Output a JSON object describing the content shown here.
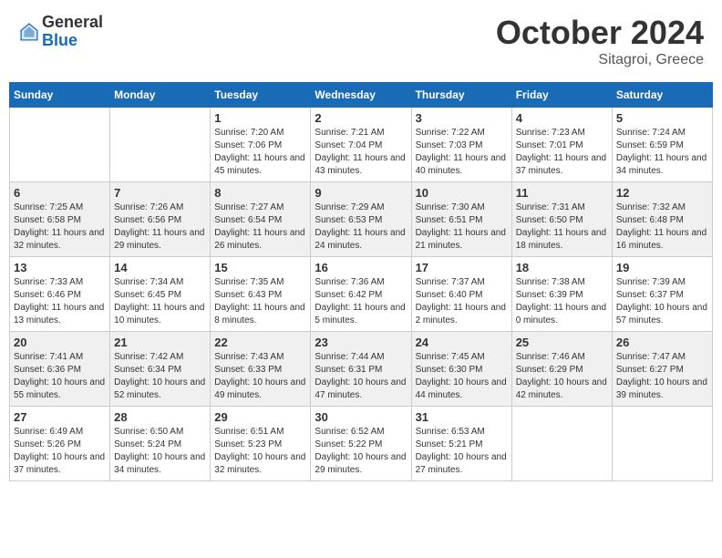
{
  "header": {
    "logo_general": "General",
    "logo_blue": "Blue",
    "month_title": "October 2024",
    "location": "Sitagroi, Greece"
  },
  "days_of_week": [
    "Sunday",
    "Monday",
    "Tuesday",
    "Wednesday",
    "Thursday",
    "Friday",
    "Saturday"
  ],
  "weeks": [
    [
      {
        "day": "",
        "info": ""
      },
      {
        "day": "",
        "info": ""
      },
      {
        "day": "1",
        "info": "Sunrise: 7:20 AM\nSunset: 7:06 PM\nDaylight: 11 hours and 45 minutes."
      },
      {
        "day": "2",
        "info": "Sunrise: 7:21 AM\nSunset: 7:04 PM\nDaylight: 11 hours and 43 minutes."
      },
      {
        "day": "3",
        "info": "Sunrise: 7:22 AM\nSunset: 7:03 PM\nDaylight: 11 hours and 40 minutes."
      },
      {
        "day": "4",
        "info": "Sunrise: 7:23 AM\nSunset: 7:01 PM\nDaylight: 11 hours and 37 minutes."
      },
      {
        "day": "5",
        "info": "Sunrise: 7:24 AM\nSunset: 6:59 PM\nDaylight: 11 hours and 34 minutes."
      }
    ],
    [
      {
        "day": "6",
        "info": "Sunrise: 7:25 AM\nSunset: 6:58 PM\nDaylight: 11 hours and 32 minutes."
      },
      {
        "day": "7",
        "info": "Sunrise: 7:26 AM\nSunset: 6:56 PM\nDaylight: 11 hours and 29 minutes."
      },
      {
        "day": "8",
        "info": "Sunrise: 7:27 AM\nSunset: 6:54 PM\nDaylight: 11 hours and 26 minutes."
      },
      {
        "day": "9",
        "info": "Sunrise: 7:29 AM\nSunset: 6:53 PM\nDaylight: 11 hours and 24 minutes."
      },
      {
        "day": "10",
        "info": "Sunrise: 7:30 AM\nSunset: 6:51 PM\nDaylight: 11 hours and 21 minutes."
      },
      {
        "day": "11",
        "info": "Sunrise: 7:31 AM\nSunset: 6:50 PM\nDaylight: 11 hours and 18 minutes."
      },
      {
        "day": "12",
        "info": "Sunrise: 7:32 AM\nSunset: 6:48 PM\nDaylight: 11 hours and 16 minutes."
      }
    ],
    [
      {
        "day": "13",
        "info": "Sunrise: 7:33 AM\nSunset: 6:46 PM\nDaylight: 11 hours and 13 minutes."
      },
      {
        "day": "14",
        "info": "Sunrise: 7:34 AM\nSunset: 6:45 PM\nDaylight: 11 hours and 10 minutes."
      },
      {
        "day": "15",
        "info": "Sunrise: 7:35 AM\nSunset: 6:43 PM\nDaylight: 11 hours and 8 minutes."
      },
      {
        "day": "16",
        "info": "Sunrise: 7:36 AM\nSunset: 6:42 PM\nDaylight: 11 hours and 5 minutes."
      },
      {
        "day": "17",
        "info": "Sunrise: 7:37 AM\nSunset: 6:40 PM\nDaylight: 11 hours and 2 minutes."
      },
      {
        "day": "18",
        "info": "Sunrise: 7:38 AM\nSunset: 6:39 PM\nDaylight: 11 hours and 0 minutes."
      },
      {
        "day": "19",
        "info": "Sunrise: 7:39 AM\nSunset: 6:37 PM\nDaylight: 10 hours and 57 minutes."
      }
    ],
    [
      {
        "day": "20",
        "info": "Sunrise: 7:41 AM\nSunset: 6:36 PM\nDaylight: 10 hours and 55 minutes."
      },
      {
        "day": "21",
        "info": "Sunrise: 7:42 AM\nSunset: 6:34 PM\nDaylight: 10 hours and 52 minutes."
      },
      {
        "day": "22",
        "info": "Sunrise: 7:43 AM\nSunset: 6:33 PM\nDaylight: 10 hours and 49 minutes."
      },
      {
        "day": "23",
        "info": "Sunrise: 7:44 AM\nSunset: 6:31 PM\nDaylight: 10 hours and 47 minutes."
      },
      {
        "day": "24",
        "info": "Sunrise: 7:45 AM\nSunset: 6:30 PM\nDaylight: 10 hours and 44 minutes."
      },
      {
        "day": "25",
        "info": "Sunrise: 7:46 AM\nSunset: 6:29 PM\nDaylight: 10 hours and 42 minutes."
      },
      {
        "day": "26",
        "info": "Sunrise: 7:47 AM\nSunset: 6:27 PM\nDaylight: 10 hours and 39 minutes."
      }
    ],
    [
      {
        "day": "27",
        "info": "Sunrise: 6:49 AM\nSunset: 5:26 PM\nDaylight: 10 hours and 37 minutes."
      },
      {
        "day": "28",
        "info": "Sunrise: 6:50 AM\nSunset: 5:24 PM\nDaylight: 10 hours and 34 minutes."
      },
      {
        "day": "29",
        "info": "Sunrise: 6:51 AM\nSunset: 5:23 PM\nDaylight: 10 hours and 32 minutes."
      },
      {
        "day": "30",
        "info": "Sunrise: 6:52 AM\nSunset: 5:22 PM\nDaylight: 10 hours and 29 minutes."
      },
      {
        "day": "31",
        "info": "Sunrise: 6:53 AM\nSunset: 5:21 PM\nDaylight: 10 hours and 27 minutes."
      },
      {
        "day": "",
        "info": ""
      },
      {
        "day": "",
        "info": ""
      }
    ]
  ]
}
